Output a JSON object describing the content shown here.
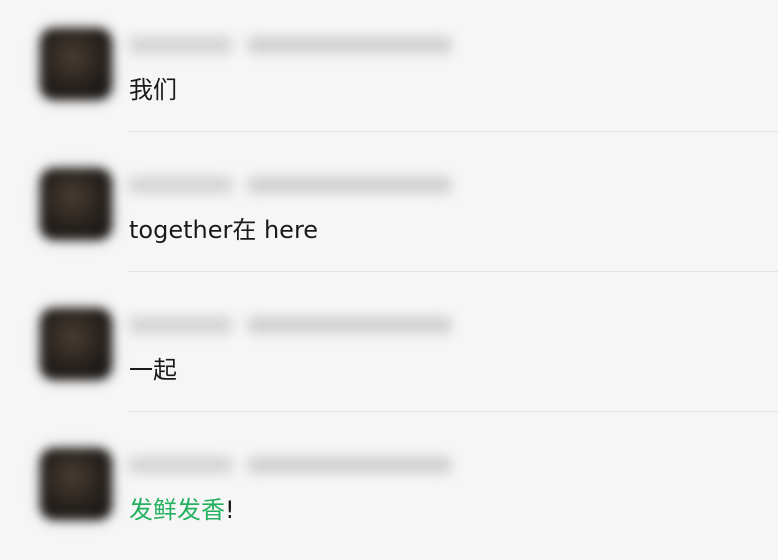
{
  "comments": [
    {
      "text": "我们"
    },
    {
      "text": "together在 here"
    },
    {
      "text": "一起"
    },
    {
      "highlight": "发鲜发香",
      "suffix": "!"
    }
  ],
  "colors": {
    "background": "#f6f6f6",
    "text": "#1a1a1a",
    "highlight": "#23b15f",
    "divider": "#e3e3e3"
  },
  "icons": {
    "avatar": "blurred-avatar-icon"
  }
}
